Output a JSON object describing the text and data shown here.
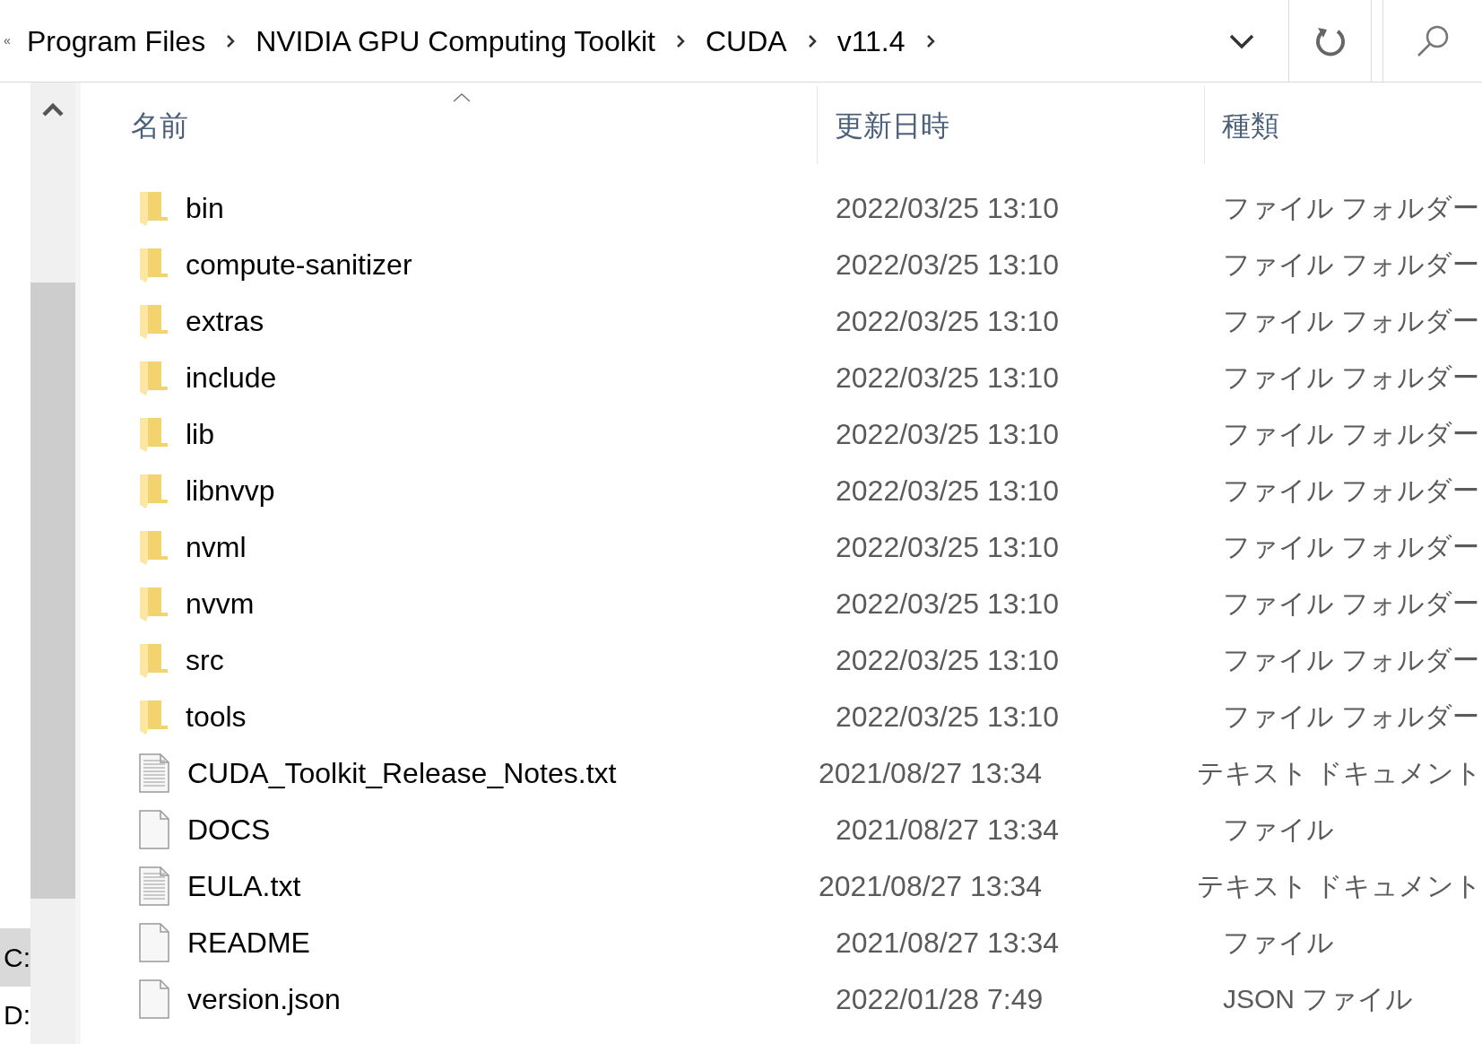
{
  "address_bar": {
    "overflow": "«",
    "breadcrumbs": [
      "Program Files",
      "NVIDIA GPU Computing Toolkit",
      "CUDA",
      "v11.4"
    ]
  },
  "nav_pane": {
    "items": [
      {
        "label": "C:",
        "selected": true
      },
      {
        "label": "D:",
        "selected": false
      }
    ]
  },
  "table": {
    "columns": [
      "名前",
      "更新日時",
      "種類"
    ],
    "rows": [
      {
        "kind": "folder",
        "name": "bin",
        "modified": "2022/03/25 13:10",
        "type": "ファイル フォルダー"
      },
      {
        "kind": "folder",
        "name": "compute-sanitizer",
        "modified": "2022/03/25 13:10",
        "type": "ファイル フォルダー"
      },
      {
        "kind": "folder",
        "name": "extras",
        "modified": "2022/03/25 13:10",
        "type": "ファイル フォルダー"
      },
      {
        "kind": "folder",
        "name": "include",
        "modified": "2022/03/25 13:10",
        "type": "ファイル フォルダー"
      },
      {
        "kind": "folder",
        "name": "lib",
        "modified": "2022/03/25 13:10",
        "type": "ファイル フォルダー"
      },
      {
        "kind": "folder",
        "name": "libnvvp",
        "modified": "2022/03/25 13:10",
        "type": "ファイル フォルダー"
      },
      {
        "kind": "folder",
        "name": "nvml",
        "modified": "2022/03/25 13:10",
        "type": "ファイル フォルダー"
      },
      {
        "kind": "folder",
        "name": "nvvm",
        "modified": "2022/03/25 13:10",
        "type": "ファイル フォルダー"
      },
      {
        "kind": "folder",
        "name": "src",
        "modified": "2022/03/25 13:10",
        "type": "ファイル フォルダー"
      },
      {
        "kind": "folder",
        "name": "tools",
        "modified": "2022/03/25 13:10",
        "type": "ファイル フォルダー"
      },
      {
        "kind": "text",
        "name": "CUDA_Toolkit_Release_Notes.txt",
        "modified": "2021/08/27 13:34",
        "type": "テキスト ドキュメント"
      },
      {
        "kind": "file",
        "name": "DOCS",
        "modified": "2021/08/27 13:34",
        "type": "ファイル"
      },
      {
        "kind": "text",
        "name": "EULA.txt",
        "modified": "2021/08/27 13:34",
        "type": "テキスト ドキュメント"
      },
      {
        "kind": "file",
        "name": "README",
        "modified": "2021/08/27 13:34",
        "type": "ファイル"
      },
      {
        "kind": "file",
        "name": "version.json",
        "modified": "2022/01/28 7:49",
        "type": "JSON ファイル"
      }
    ]
  }
}
